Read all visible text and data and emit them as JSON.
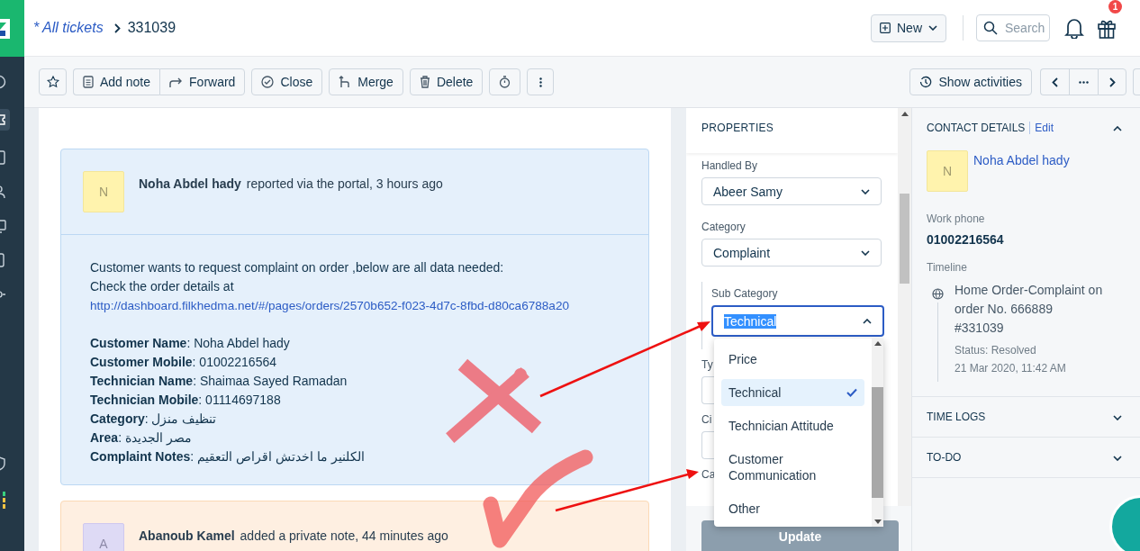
{
  "header": {
    "breadcrumb": "* All tickets",
    "ticket_id": "331039",
    "new_button": "New",
    "search": {
      "placeholder": "Search"
    },
    "notification_badge": "1"
  },
  "toolbar": {
    "actions": [
      {
        "label": "Add note"
      },
      {
        "label": "Forward"
      },
      {
        "label": "Close"
      },
      {
        "label": "Merge"
      },
      {
        "label": "Delete"
      }
    ],
    "show_activities": "Show activities"
  },
  "conversation": [
    {
      "kind": "public",
      "avatar": "N",
      "author": "Noha Abdel hady",
      "action": "reported via the portal, 3 hours ago",
      "intro": "Customer wants to request complaint on order ,below are all data needed:",
      "link_prefix": "Check the order details at",
      "link": "http://dashboard.filkhedma.net/#/pages/orders/2570b652-f023-4d7c-8fbd-d80ca6788a20",
      "details": [
        "**Customer Name**: Noha Abdel hady",
        "**Customer Mobile**: 01002216564",
        "**Technician Name**: Shaimaa Sayed Ramadan",
        "**Technician Mobile**: 01114697188",
        "**Category**: تنظيف منزل",
        "**Area**: مصر الجديدة",
        "**Complaint Notes**: الكلنير ما اخدتش اقراص التعقيم"
      ]
    },
    {
      "kind": "private",
      "avatar": "A",
      "author": "Abanoub Kamel",
      "action": "added a private note, 44 minutes ago"
    }
  ],
  "properties": {
    "title": "PROPERTIES",
    "fields": [
      {
        "label": "Handled By",
        "value": "Abeer Samy"
      },
      {
        "label": "Category",
        "value": "Complaint"
      }
    ],
    "sub_category": {
      "label": "Sub Category",
      "value": "Technical",
      "options": [
        {
          "label": "Price",
          "selected": false
        },
        {
          "label": "Technical",
          "selected": true
        },
        {
          "label": "Technician Attitude",
          "selected": false
        },
        {
          "label": "Customer Communication",
          "selected": false
        },
        {
          "label": "Other",
          "selected": false
        }
      ]
    },
    "covered_labels": [
      "Ty",
      "Ci",
      "Ca"
    ],
    "update_button": {
      "label": "Update",
      "disabled": true
    }
  },
  "contact": {
    "title": "CONTACT DETAILS",
    "edit": "Edit",
    "expanded": true,
    "avatar": "N",
    "name": "Noha Abdel hady",
    "work_phone_label": "Work phone",
    "work_phone": "01002216564",
    "timeline_label": "Timeline",
    "timeline": {
      "title": "Home Order-Complaint on order No. 666889",
      "id": "#331039",
      "status": "Status: Resolved",
      "date": "21 Mar 2020, 11:42 AM"
    }
  },
  "sections": [
    {
      "title": "TIME LOGS",
      "expanded": false
    },
    {
      "title": "TO-DO",
      "expanded": false
    }
  ]
}
